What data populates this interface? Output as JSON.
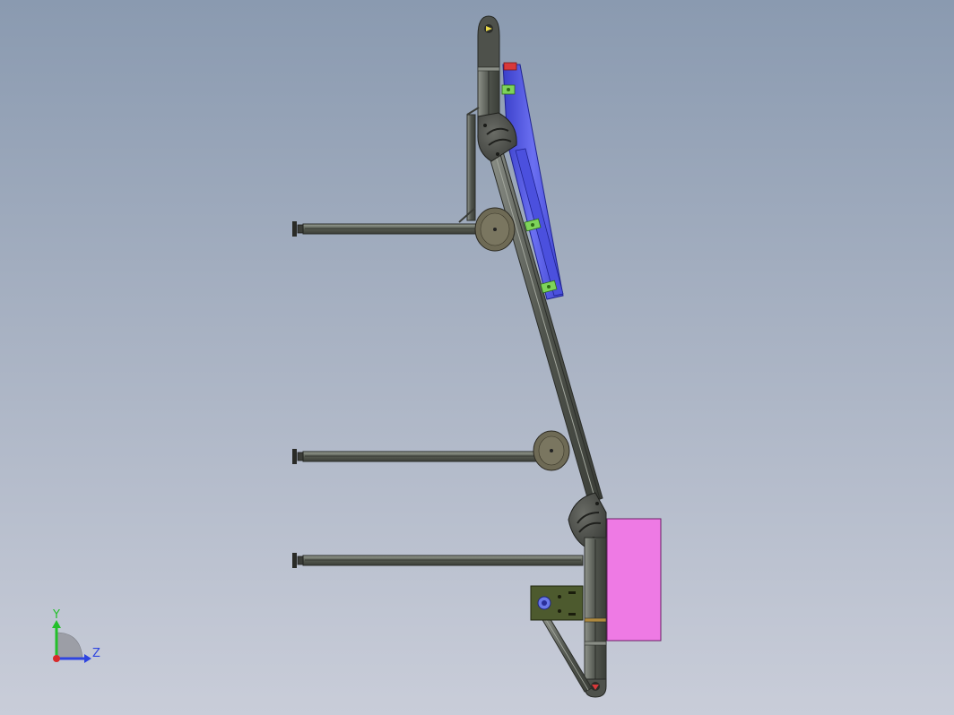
{
  "viewport": {
    "background_top": "#8a9ab0",
    "background_bottom": "#c9cdd9"
  },
  "colors": {
    "frame_profile": "#5a5e58",
    "frame_edge": "#2c2f2b",
    "frame_light": "#8d918a",
    "gusset_plate": "#4a4d49",
    "blue_rail": "#5a5ee8",
    "green_clip": "#7ed35a",
    "magenta_box": "#ee7ae4",
    "motor_plate": "#4d5a2e",
    "red_accent": "#d8383a"
  },
  "triad": {
    "y_label": "Y",
    "z_label": "Z",
    "y_color": "#23c02a",
    "z_color": "#2e44e0",
    "x_color": "#d82a2a",
    "icons": [
      "y-axis-arrow-icon",
      "z-axis-arrow-icon",
      "origin-icon"
    ]
  }
}
